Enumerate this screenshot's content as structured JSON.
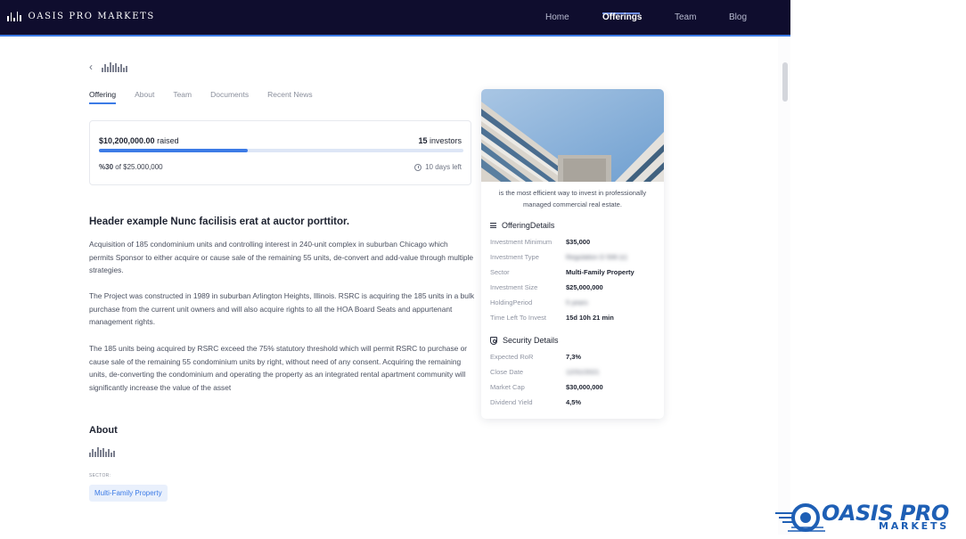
{
  "nav": {
    "brand": "OASIS PRO MARKETS",
    "links": [
      {
        "label": "Home",
        "active": false
      },
      {
        "label": "Offerings",
        "active": true
      },
      {
        "label": "Team",
        "active": false
      },
      {
        "label": "Blog",
        "active": false
      }
    ]
  },
  "tabs": [
    {
      "label": "Offering",
      "active": true
    },
    {
      "label": "About",
      "active": false
    },
    {
      "label": "Team",
      "active": false
    },
    {
      "label": "Documents",
      "active": false
    },
    {
      "label": "Recent News",
      "active": false
    }
  ],
  "raise": {
    "amount": "$10,200,000.00",
    "raised_label": "raised",
    "investor_count": "15",
    "investors_label": "investors",
    "progress_fraction": 0.408,
    "percent": "%30",
    "of_goal": "of $25.000,000",
    "days_left": "10 days left"
  },
  "article": {
    "title": "Header example Nunc facilisis erat at auctor porttitor.",
    "paragraphs": [
      "Acquisition of 185 condominium units and controlling interest in 240-unit complex in suburban Chicago which permits Sponsor to either acquire or cause sale of the remaining 55 units, de-convert and add-value through multiple strategies.",
      "The Project was constructed in 1989 in suburban Arlington Heights, Illinois. RSRC is acquiring the 185 units in a bulk purchase from the current unit owners and will also acquire rights to all the HOA Board Seats and appurtenant management rights.",
      "The 185 units being acquired by RSRC exceed the 75% statutory threshold which will permit RSRC to purchase or cause sale of the remaining 55 condominium units by right, without need of any consent. Acquiring the remaining units, de-converting the condominium and operating the property as an integrated rental apartment community will significantly increase the value of the asset"
    ]
  },
  "about": {
    "title": "About",
    "sector_label": "SECTOR:",
    "sector_value": "Multi-Family Property"
  },
  "sidebar": {
    "tagline": "is the most efficient way to invest in professionally managed commercial real estate.",
    "offering_title": "OfferingDetails",
    "offering_rows": [
      {
        "label": "Investment Minimum",
        "value": "$35,000",
        "blurred": false
      },
      {
        "label": "Investment Type",
        "value": "Regulation D 506 (c)",
        "blurred": true
      },
      {
        "label": "Sector",
        "value": "Multi-Family Property",
        "blurred": false
      },
      {
        "label": "Investment Size",
        "value": "$25,000,000",
        "blurred": false
      },
      {
        "label": "HoldingPeriod",
        "value": "5 years",
        "blurred": true
      },
      {
        "label": "Time Left To Invest",
        "value": "15d 10h 21 min",
        "blurred": false
      }
    ],
    "security_title": "Security Details",
    "security_rows": [
      {
        "label": "Expected RoR",
        "value": "7,3%",
        "blurred": false
      },
      {
        "label": "Close Date",
        "value": "12/31/2021",
        "blurred": true
      },
      {
        "label": "Market Cap",
        "value": "$30,000,000",
        "blurred": false
      },
      {
        "label": "Dividend Yield",
        "value": "4,5%",
        "blurred": false
      }
    ]
  },
  "watermark": {
    "line1": "OASIS PRO",
    "line2": "MARKETS"
  },
  "colors": {
    "nav_bg": "#0f0d2e",
    "accent": "#3c7be6",
    "watermark": "#1e5fb5"
  }
}
